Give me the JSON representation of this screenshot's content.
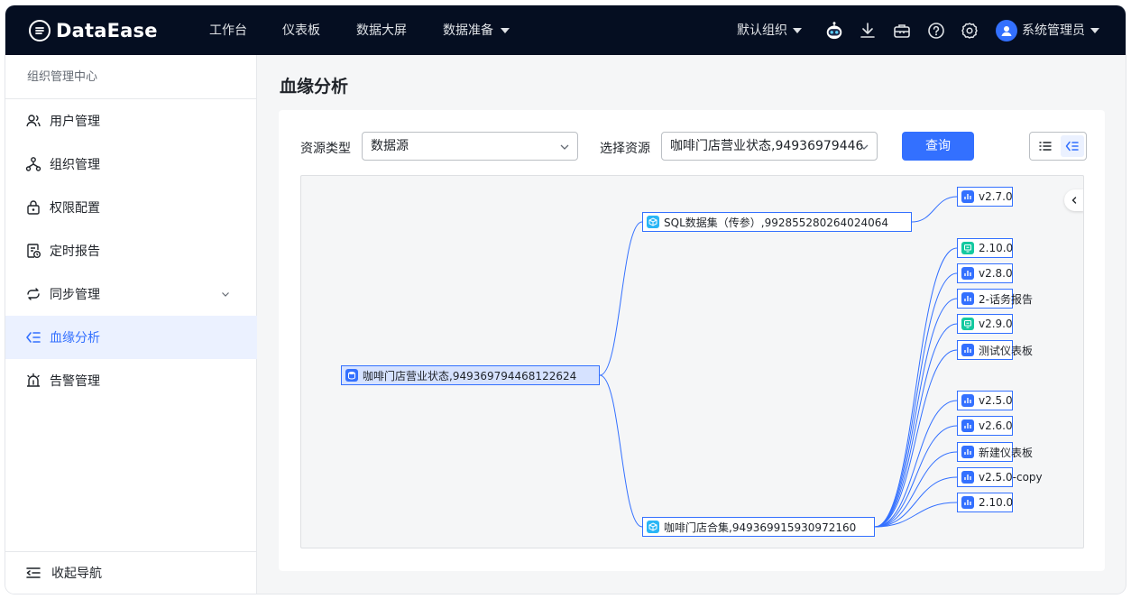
{
  "app": {
    "logo_text": "DataEase",
    "nav": [
      "工作台",
      "仪表板",
      "数据大屏",
      "数据准备"
    ],
    "org_label": "默认组织",
    "user_label": "系统管理员"
  },
  "sidebar": {
    "header": "组织管理中心",
    "items": [
      {
        "label": "用户管理",
        "icon": "users-icon"
      },
      {
        "label": "组织管理",
        "icon": "org-tree-icon"
      },
      {
        "label": "权限配置",
        "icon": "lock-icon"
      },
      {
        "label": "定时报告",
        "icon": "report-clock-icon"
      },
      {
        "label": "同步管理",
        "icon": "sync-icon"
      },
      {
        "label": "血缘分析",
        "icon": "lineage-icon",
        "active": true
      },
      {
        "label": "告警管理",
        "icon": "alarm-icon"
      }
    ],
    "collapse_label": "收起导航"
  },
  "main": {
    "title": "血缘分析",
    "filters": {
      "resource_type_label": "资源类型",
      "resource_type_value": "数据源",
      "resource_label": "选择资源",
      "resource_value": "咖啡门店营业状态,94936979446"
    },
    "query_button": "查询"
  },
  "graph": {
    "root": {
      "label": "咖啡门店营业状态,949369794468122624",
      "type": "datasource"
    },
    "datasets": [
      {
        "label": "SQL数据集（传参）,992855280264024064",
        "type": "dataset"
      },
      {
        "label": "咖啡门店合集,949369915930972160",
        "type": "dataset"
      }
    ],
    "leaves_sql": [
      {
        "label": "v2.7.0",
        "type": "panel"
      }
    ],
    "leaves_store": [
      {
        "label": "2.10.0",
        "type": "screen"
      },
      {
        "label": "v2.8.0",
        "type": "panel"
      },
      {
        "label": "2-话务报告",
        "type": "panel"
      },
      {
        "label": "v2.9.0",
        "type": "screen"
      },
      {
        "label": "测试仪表板",
        "type": "panel"
      },
      {
        "label": "v2.5.0",
        "type": "panel"
      },
      {
        "label": "v2.6.0",
        "type": "panel"
      },
      {
        "label": "新建仪表板",
        "type": "panel"
      },
      {
        "label": "v2.5.0-copy",
        "type": "panel"
      },
      {
        "label": "2.10.0",
        "type": "panel"
      }
    ]
  },
  "colors": {
    "primary": "#3370ff",
    "topbar": "#050e21",
    "dataset_icon": "#29b6f6",
    "screen_icon": "#14c9a0",
    "panel_icon": "#3370ff",
    "edge": "#3370ff"
  }
}
